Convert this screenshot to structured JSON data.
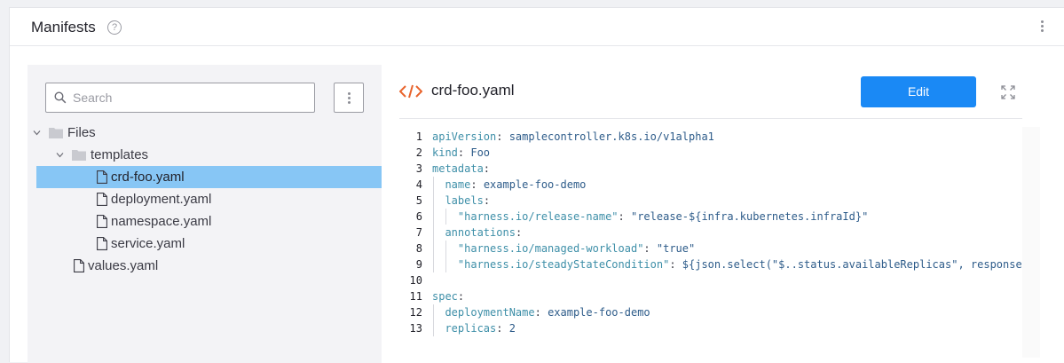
{
  "panel": {
    "title": "Manifests",
    "help_icon": "question-circle-icon",
    "menu_icon": "kebab-vertical-icon"
  },
  "tree": {
    "search": {
      "placeholder": "Search",
      "value": "",
      "icon": "search-icon"
    },
    "menu_icon": "kebab-vertical-icon",
    "items": [
      {
        "label": "Files",
        "type": "folder",
        "expanded": true,
        "selected": false
      },
      {
        "label": "templates",
        "type": "folder",
        "expanded": true,
        "selected": false
      },
      {
        "label": "crd-foo.yaml",
        "type": "file",
        "selected": true
      },
      {
        "label": "deployment.yaml",
        "type": "file",
        "selected": false
      },
      {
        "label": "namespace.yaml",
        "type": "file",
        "selected": false
      },
      {
        "label": "service.yaml",
        "type": "file",
        "selected": false
      },
      {
        "label": "values.yaml",
        "type": "file",
        "selected": false
      }
    ]
  },
  "editor": {
    "file_icon": "code-brackets-icon",
    "filename": "crd-foo.yaml",
    "edit_label": "Edit",
    "expand_icon": "expand-icon",
    "colors": {
      "accent": "#1a89f5",
      "selected_row": "#87c6f5",
      "code_icon": "#e8632b"
    },
    "lines": [
      {
        "num": "1",
        "key": "apiVersion",
        "sep": ": ",
        "value": "samplecontroller.k8s.io/v1alpha1"
      },
      {
        "num": "2",
        "key": "kind",
        "sep": ": ",
        "value": "Foo"
      },
      {
        "num": "3",
        "key": "metadata",
        "sep": ":",
        "value": ""
      },
      {
        "num": "4",
        "key": "name",
        "sep": ": ",
        "value": "example-foo-demo"
      },
      {
        "num": "5",
        "key": "labels",
        "sep": ":",
        "value": ""
      },
      {
        "num": "6",
        "key": "\"harness.io/release-name\"",
        "sep": ": ",
        "value": "\"release-${infra.kubernetes.infraId}\""
      },
      {
        "num": "7",
        "key": "annotations",
        "sep": ":",
        "value": ""
      },
      {
        "num": "8",
        "key": "\"harness.io/managed-workload\"",
        "sep": ": ",
        "value": "\"true\""
      },
      {
        "num": "9",
        "key": "\"harness.io/steadyStateCondition\"",
        "sep": ": ",
        "value": "${json.select(\"$..status.availableReplicas\", response) =="
      },
      {
        "num": "10",
        "key": "",
        "sep": "",
        "value": ""
      },
      {
        "num": "11",
        "key": "spec",
        "sep": ":",
        "value": ""
      },
      {
        "num": "12",
        "key": "deploymentName",
        "sep": ": ",
        "value": "example-foo-demo"
      },
      {
        "num": "13",
        "key": "replicas",
        "sep": ": ",
        "value": "2"
      }
    ]
  }
}
